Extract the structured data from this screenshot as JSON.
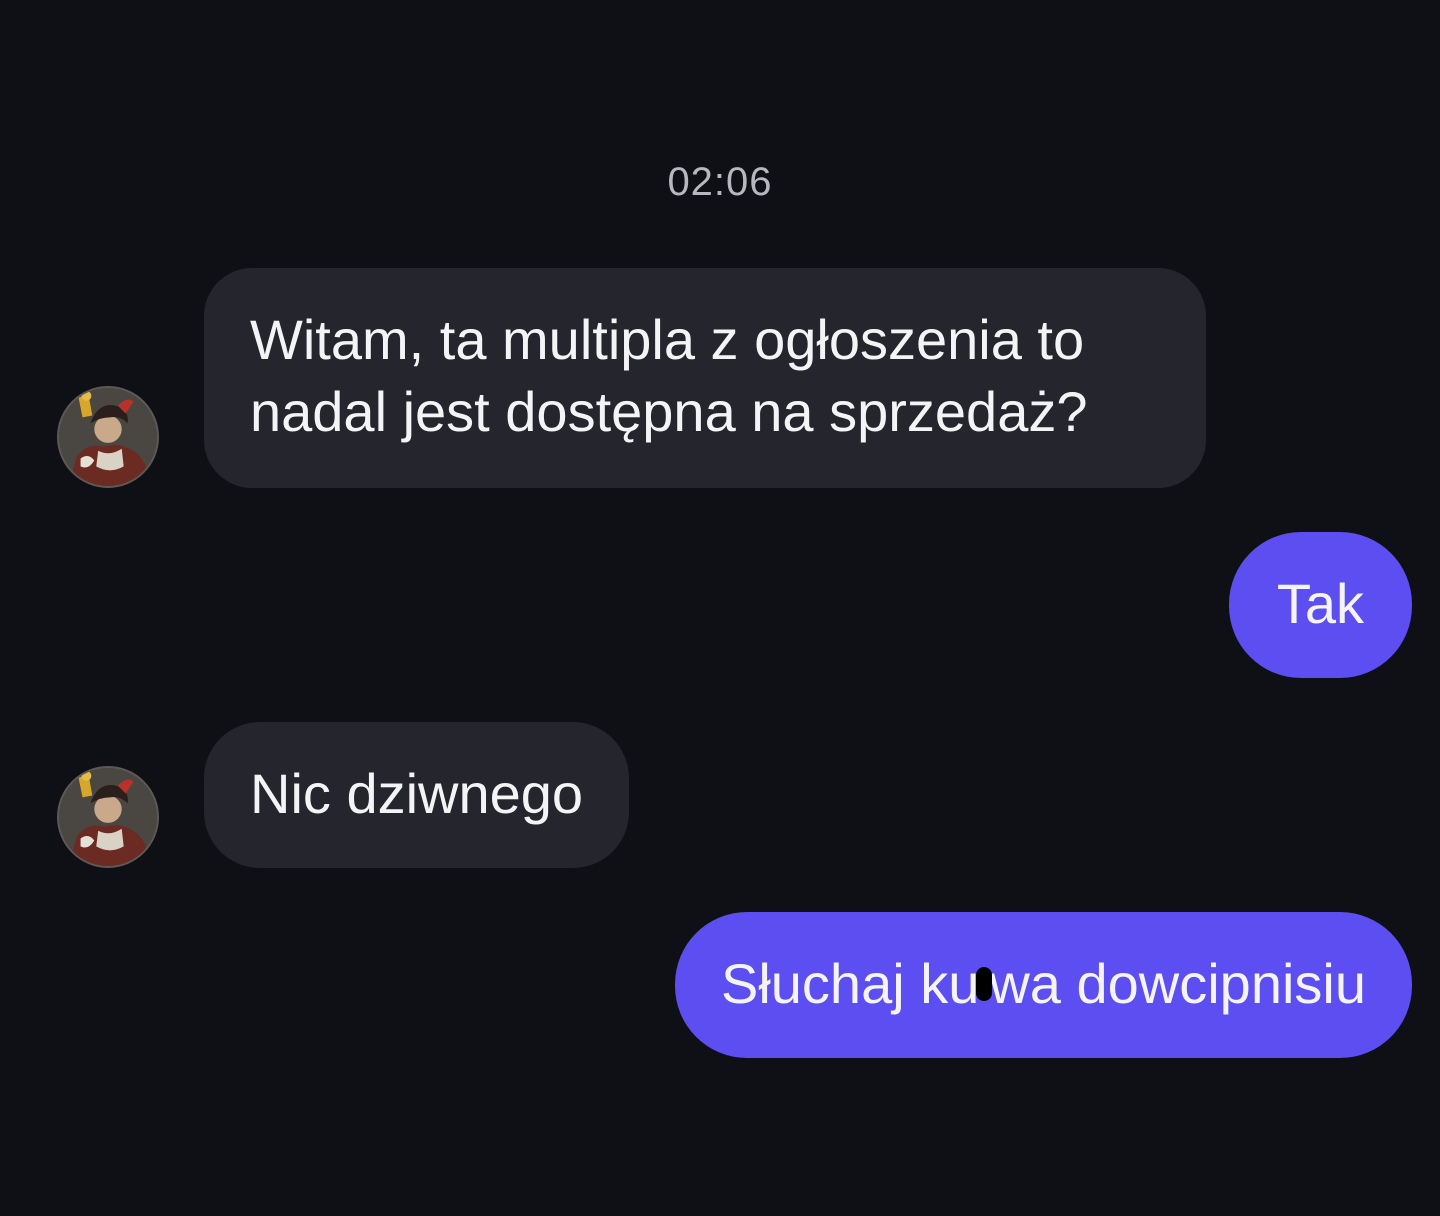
{
  "conversation": {
    "timestamp": "02:06",
    "messages": [
      {
        "direction": "incoming",
        "lines": [
          "Witam, ta multipla z ogłoszenia to",
          "nadal jest dostępna na sprzedaż?"
        ]
      },
      {
        "direction": "outgoing",
        "text": "Tak"
      },
      {
        "direction": "incoming",
        "text": "Nic dziwnego"
      },
      {
        "direction": "outgoing",
        "text_before": "Słuchaj ku",
        "text_after": "wa dowcipnisiu"
      }
    ]
  },
  "avatar": {
    "icon": "jester-portrait-avatar"
  },
  "colors": {
    "background": "#0f1016",
    "incoming_bubble": "#25262d",
    "outgoing_bubble": "#5c4ef0",
    "text": "#f4f4f6",
    "timestamp": "#b7b8bf"
  }
}
